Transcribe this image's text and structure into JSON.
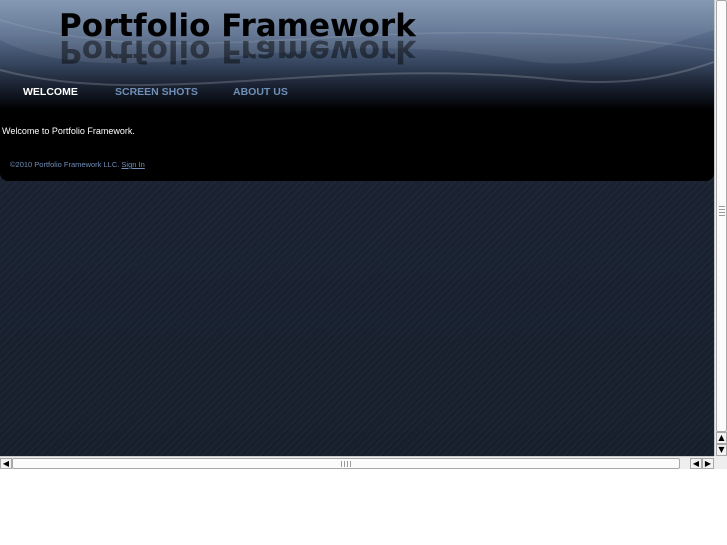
{
  "site": {
    "title": "Portfolio Framework"
  },
  "nav": {
    "items": [
      {
        "label": "WELCOME",
        "active": true
      },
      {
        "label": "SCREEN SHOTS",
        "active": false
      },
      {
        "label": "ABOUT US",
        "active": false
      }
    ]
  },
  "main": {
    "welcome_text": "Welcome to Portfolio Framework."
  },
  "footer": {
    "copyright": "©2010 Portfolio Framework LLC.",
    "sign_in_label": "Sign In"
  },
  "colors": {
    "page_background": "#1a2231",
    "panel_background": "#000000",
    "nav_active": "#ffffff",
    "nav_inactive": "#6f8fb7",
    "title_color": "#000000"
  },
  "icons": {
    "scroll_up": "arrow-up-icon",
    "scroll_down": "arrow-down-icon",
    "scroll_left": "arrow-left-icon",
    "scroll_right": "arrow-right-icon"
  }
}
